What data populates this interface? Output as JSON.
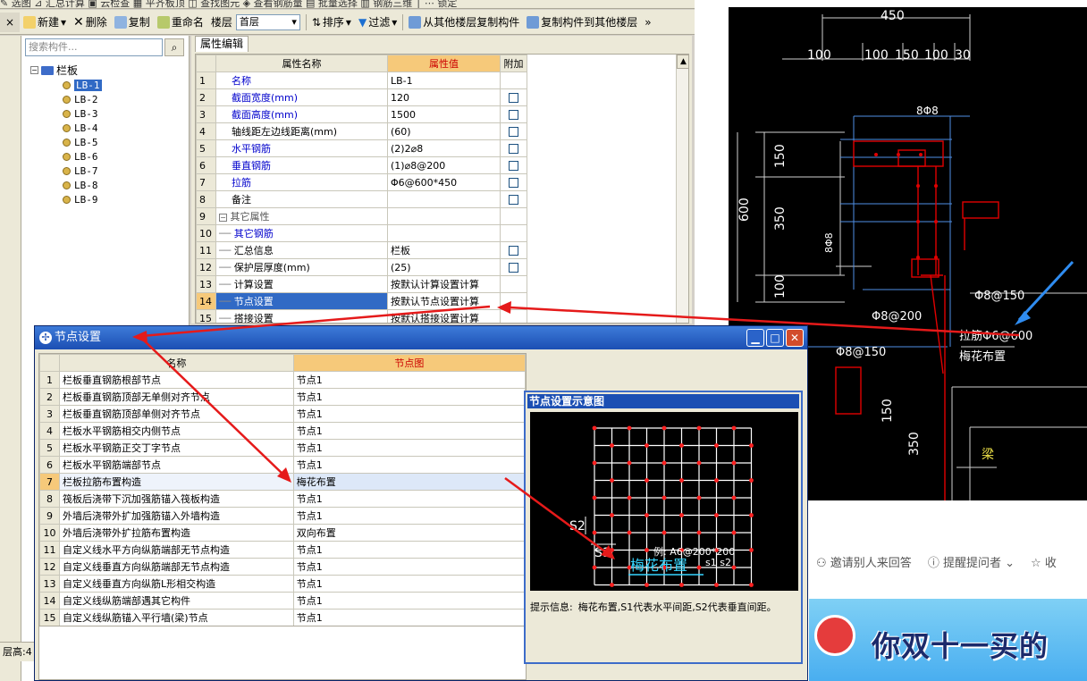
{
  "menubar": {
    "text": "✎ 选图  ⊿ 汇总计算  ▣ 云检查  ▦ 平齐板顶  ◫ 查找图元  ◈ 查看钢筋量  ▤ 批量选择  ▥ 钢筋三维  │  ⋯ 锁定"
  },
  "toolbar": {
    "new_label": "新建",
    "delete_label": "删除",
    "copy_label": "复制",
    "rename_label": "重命名",
    "floor_label": "楼层",
    "floor_value": "首层",
    "sort_label": "排序",
    "filter_label": "过滤",
    "copy_from_label": "从其他楼层复制构件",
    "copy_to_label": "复制构件到其他楼层",
    "more_label": "»"
  },
  "tree": {
    "search_placeholder": "搜索构件...",
    "root_label": "栏板",
    "items": [
      "LB-1",
      "LB-2",
      "LB-3",
      "LB-4",
      "LB-5",
      "LB-6",
      "LB-7",
      "LB-8",
      "LB-9"
    ]
  },
  "props": {
    "tab_label": "属性编辑",
    "headers": {
      "name": "属性名称",
      "value": "属性值",
      "extra": "附加"
    },
    "rows": [
      {
        "n": "1",
        "name": "名称",
        "value": "LB-1"
      },
      {
        "n": "2",
        "name": "截面宽度(mm)",
        "value": "120"
      },
      {
        "n": "3",
        "name": "截面高度(mm)",
        "value": "1500"
      },
      {
        "n": "4",
        "name": "轴线距左边线距离(mm)",
        "value": "(60)"
      },
      {
        "n": "5",
        "name": "水平钢筋",
        "value": "(2)2⌀8"
      },
      {
        "n": "6",
        "name": "垂直钢筋",
        "value": "(1)⌀8@200"
      },
      {
        "n": "7",
        "name": "拉筋",
        "value": "Φ6@600*450"
      },
      {
        "n": "8",
        "name": "备注",
        "value": ""
      },
      {
        "n": "9",
        "name": "其它属性",
        "value": ""
      },
      {
        "n": "10",
        "name": "其它钢筋",
        "value": ""
      },
      {
        "n": "11",
        "name": "汇总信息",
        "value": "栏板"
      },
      {
        "n": "12",
        "name": "保护层厚度(mm)",
        "value": "(25)"
      },
      {
        "n": "13",
        "name": "计算设置",
        "value": "按默认计算设置计算"
      },
      {
        "n": "14",
        "name": "节点设置",
        "value": "按默认节点设置计算"
      },
      {
        "n": "15",
        "name": "搭接设置",
        "value": "按默认搭接设置计算"
      }
    ]
  },
  "status": {
    "floor_height": "层高:4"
  },
  "dialog": {
    "title": "节点设置",
    "headers": {
      "name": "名称",
      "value": "节点图"
    },
    "rows": [
      {
        "n": "1",
        "name": "栏板垂直钢筋根部节点",
        "value": "节点1"
      },
      {
        "n": "2",
        "name": "栏板垂直钢筋顶部无单侧对齐节点",
        "value": "节点1"
      },
      {
        "n": "3",
        "name": "栏板垂直钢筋顶部单侧对齐节点",
        "value": "节点1"
      },
      {
        "n": "4",
        "name": "栏板水平钢筋相交内侧节点",
        "value": "节点1"
      },
      {
        "n": "5",
        "name": "栏板水平钢筋正交丁字节点",
        "value": "节点1"
      },
      {
        "n": "6",
        "name": "栏板水平钢筋端部节点",
        "value": "节点1"
      },
      {
        "n": "7",
        "name": "栏板拉筋布置构造",
        "value": "梅花布置"
      },
      {
        "n": "8",
        "name": "筏板后浇带下沉加强筋锚入筏板构造",
        "value": "节点1"
      },
      {
        "n": "9",
        "name": "外墙后浇带外扩加强筋锚入外墙构造",
        "value": "节点1"
      },
      {
        "n": "10",
        "name": "外墙后浇带外扩拉筋布置构造",
        "value": "双向布置"
      },
      {
        "n": "11",
        "name": "自定义线水平方向纵筋端部无节点构造",
        "value": "节点1"
      },
      {
        "n": "12",
        "name": "自定义线垂直方向纵筋端部无节点构造",
        "value": "节点1"
      },
      {
        "n": "13",
        "name": "自定义线垂直方向纵筋L形相交构造",
        "value": "节点1"
      },
      {
        "n": "14",
        "name": "自定义线纵筋端部遇其它构件",
        "value": "节点1"
      },
      {
        "n": "15",
        "name": "自定义线纵筋锚入平行墙(梁)节点",
        "value": "节点1"
      }
    ],
    "min_icon": "minimize-icon",
    "max_icon": "maximize-icon",
    "close_icon": "close-icon"
  },
  "preview": {
    "title": "节点设置示意图",
    "s1": "S1",
    "s2": "S2",
    "example": "例: A6@200*200",
    "s1s2": "s1  s2",
    "caption": "梅花布置",
    "hint_label": "提示信息:",
    "hint_text": "梅花布置,S1代表水平间距,S2代表垂直间距。"
  },
  "cad": {
    "dims_top": [
      "450",
      "100",
      "100",
      "150",
      "100",
      "30"
    ],
    "rebar_top": "8Φ8",
    "dims_left": [
      "150",
      "350",
      "100",
      "600"
    ],
    "mid_label": "8Φ8",
    "labels": [
      "Φ8@150",
      "Φ8@200",
      "拉筋Φ6@600",
      "Φ8@150",
      "梅花布置"
    ],
    "dims_bottom": [
      "150",
      "350"
    ],
    "beam_label": "梁",
    "accent": "#e00000"
  },
  "qa": {
    "invite_label": "邀请别人来回答",
    "remind_label": "提醒提问者",
    "collect_label": "收"
  },
  "banner": {
    "text": "你双十一买的"
  }
}
